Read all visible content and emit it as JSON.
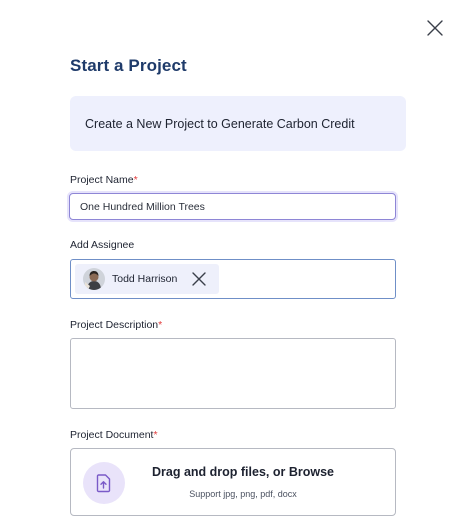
{
  "modal": {
    "title": "Start a Project",
    "banner_text": "Create a New Project to Generate Carbon Credit"
  },
  "project_name": {
    "label": "Project Name",
    "required_mark": "*",
    "value": "One Hundred Million Trees"
  },
  "assignee": {
    "label": "Add Assignee",
    "chips": [
      {
        "name": "Todd Harrison",
        "avatar_icon": "user-avatar"
      }
    ]
  },
  "description": {
    "label": "Project Description",
    "required_mark": "*",
    "value": ""
  },
  "document": {
    "label": "Project Document",
    "required_mark": "*",
    "drop_title": "Drag and drop files, or Browse",
    "drop_subtitle": "Support jpg, png, pdf, docx",
    "icon": "upload-icon"
  },
  "colors": {
    "title": "#1f3b6a",
    "banner_bg": "#eef0fd",
    "required": "#e23b3b",
    "focus_border": "#8e86d6",
    "upload_circle": "#e9e3fa",
    "upload_icon": "#7a5ac8"
  }
}
